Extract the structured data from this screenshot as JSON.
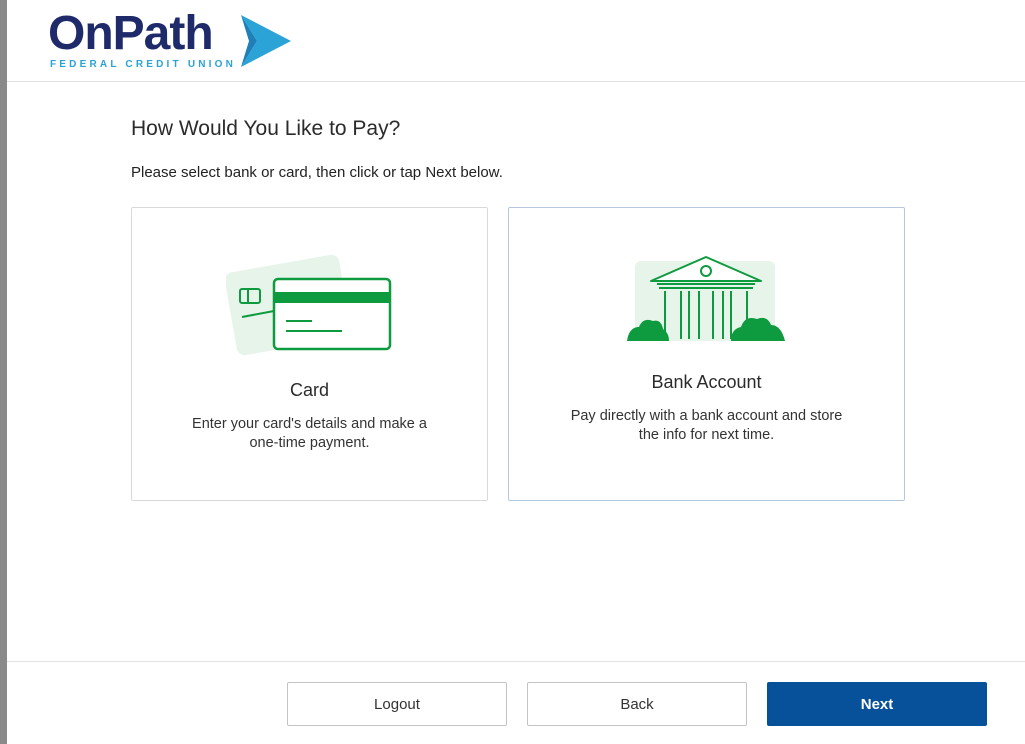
{
  "brand": {
    "name": "OnPath",
    "tagline": "FEDERAL CREDIT UNION",
    "colors": {
      "navy": "#1f2a6b",
      "cyan": "#2ba3d6",
      "accent": "#07509a",
      "green": "#0e9a3e"
    }
  },
  "page": {
    "title": "How Would You Like to Pay?",
    "instruction": "Please select bank or card, then click or tap Next below."
  },
  "options": [
    {
      "id": "card",
      "icon": "credit-card-icon",
      "title": "Card",
      "description_line1": "Enter your card's details and make a",
      "description_line2": "one-time payment."
    },
    {
      "id": "bank",
      "icon": "bank-building-icon",
      "title": "Bank Account",
      "description_line1": "Pay directly with a bank account and store",
      "description_line2": "the info for next time."
    }
  ],
  "footer": {
    "logout_label": "Logout",
    "back_label": "Back",
    "next_label": "Next"
  }
}
